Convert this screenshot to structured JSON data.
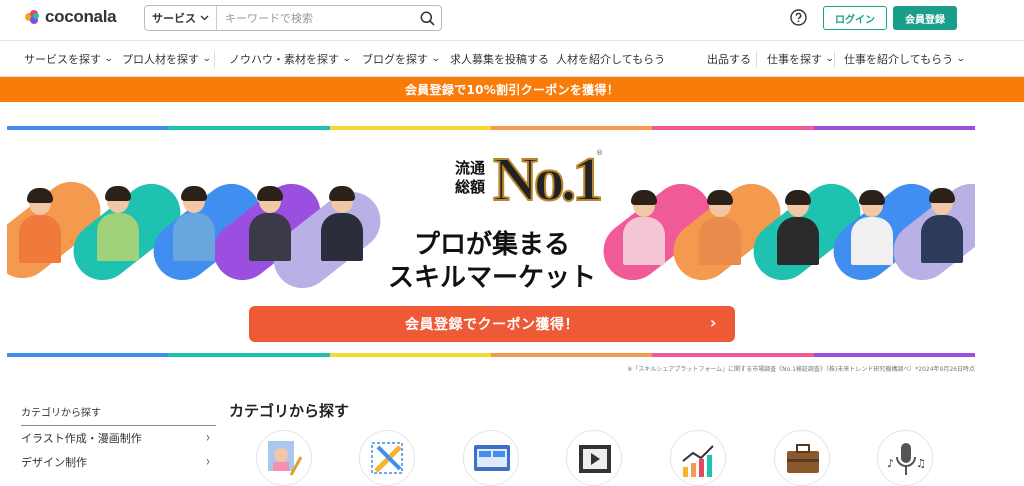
{
  "header": {
    "logo_text": "coconala",
    "search": {
      "category": "サービス",
      "placeholder": "キーワードで検索"
    },
    "login_label": "ログイン",
    "signup_label": "会員登録"
  },
  "nav": {
    "items": [
      {
        "label": "サービスを探す",
        "has_dropdown": true
      },
      {
        "label": "プロ人材を探す",
        "has_dropdown": true
      },
      {
        "label": "ノウハウ・素材を探す",
        "has_dropdown": true
      },
      {
        "label": "ブログを探す",
        "has_dropdown": true
      },
      {
        "label": "求人募集を投稿する",
        "has_dropdown": false
      },
      {
        "label": "人材を紹介してもらう",
        "has_dropdown": false
      },
      {
        "label": "出品する",
        "has_dropdown": false
      },
      {
        "label": "仕事を探す",
        "has_dropdown": true
      },
      {
        "label": "仕事を紹介してもらう",
        "has_dropdown": true
      }
    ]
  },
  "promo_banner": "会員登録で10%割引クーポンを獲得！",
  "hero": {
    "no1_label_line1": "流通",
    "no1_label_line2": "総額",
    "no1_text": "No.1",
    "no1_mark": "®",
    "tagline_line1": "プロが集まる",
    "tagline_line2": "スキルマーケット",
    "cta_label": "会員登録でクーポン獲得！",
    "cta_arrow": "›",
    "footnote": "※「スキルシェアプラットフォーム」に関する市場調査《No.1検証調査》（株)未来トレンド研究機構調べ）*2024年9月26日時点"
  },
  "sidebar": {
    "title": "カテゴリから探す",
    "items": [
      {
        "label": "イラスト作成・漫画制作"
      },
      {
        "label": "デザイン制作"
      }
    ]
  },
  "main": {
    "title": "カテゴリから探す"
  },
  "colors": {
    "brand_teal": "#1a9e8a",
    "banner_orange": "#f97c0a",
    "cta_red": "#ee5a36",
    "stripe": [
      "#3f8ef0",
      "#1fc1b1",
      "#f5d932",
      "#f49a4e",
      "#f05a97",
      "#9b4fe0"
    ]
  }
}
